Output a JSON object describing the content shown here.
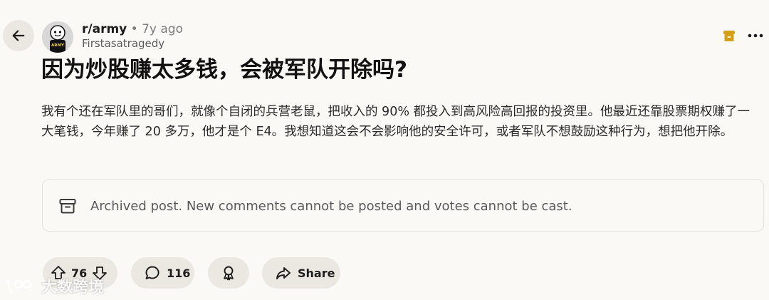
{
  "header": {
    "subreddit": "r/army",
    "separator": "•",
    "age": "7y ago",
    "author": "Firstasatragedy",
    "avatar_text": "ARMY"
  },
  "post": {
    "title": "因为炒股赚太多钱，会被军队开除吗?",
    "body": "我有个还在军队里的哥们，就像个自闭的兵营老鼠，把收入的 90% 都投入到高风险高回报的投资里。他最近还靠股票期权赚了一大笔钱，今年赚了 20 多万，他才是个 E4。我想知道这会不会影响他的安全许可，或者军队不想鼓励这种行为，想把他开除。"
  },
  "archived": {
    "message": "Archived post. New comments cannot be posted and votes cannot be cast."
  },
  "actions": {
    "votes": "76",
    "comments": "116",
    "share_label": "Share"
  },
  "watermark": {
    "text": "大数跨境"
  },
  "colors": {
    "background": "#faf9f6",
    "pill": "#ebe8e1",
    "archive_badge": "#d4a017"
  },
  "icons": {
    "back": "arrow-left-icon",
    "archive_badge": "archive-box-icon",
    "more": "more-horizontal-icon",
    "upvote": "upvote-arrow-icon",
    "downvote": "downvote-arrow-icon",
    "comment": "speech-bubble-icon",
    "award": "award-ribbon-icon",
    "share": "share-arrow-icon"
  }
}
